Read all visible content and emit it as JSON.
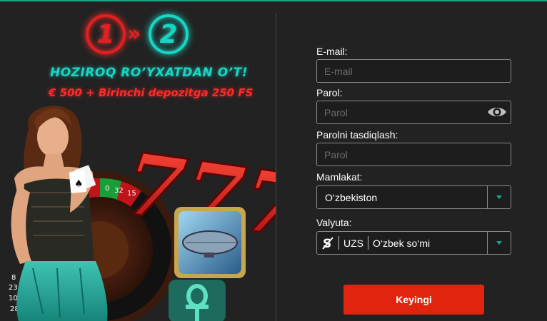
{
  "promo": {
    "step1": "1",
    "step2": "2",
    "step_arrow": "»",
    "headline": "HOZIROQ RO’YXATDAN O’T!",
    "bonus": "€ 500 + Birinchi depozitga 250 FS",
    "roulette_numbers": [
      "0",
      "32",
      "15",
      "8",
      "23",
      "10",
      "28"
    ],
    "slot_symbol": "777"
  },
  "form": {
    "email": {
      "label": "E-mail:",
      "placeholder": "E-mail",
      "value": ""
    },
    "password": {
      "label": "Parol:",
      "placeholder": "Parol",
      "value": "",
      "icon": "eye-icon"
    },
    "password_confirm": {
      "label": "Parolni tasdiqlash:",
      "placeholder": "Parol",
      "value": ""
    },
    "country": {
      "label": "Mamlakat:",
      "value": "O‘zbekiston"
    },
    "currency": {
      "label": "Valyuta:",
      "icon_glyph": "S",
      "code": "UZS",
      "name": "O‘zbek so‘mi"
    },
    "submit_label": "Keyingi"
  },
  "colors": {
    "accent": "#1ea58a",
    "button": "#e0240f",
    "neon_red": "#ff2a2a",
    "neon_teal": "#19d6c4",
    "background": "#222222"
  }
}
